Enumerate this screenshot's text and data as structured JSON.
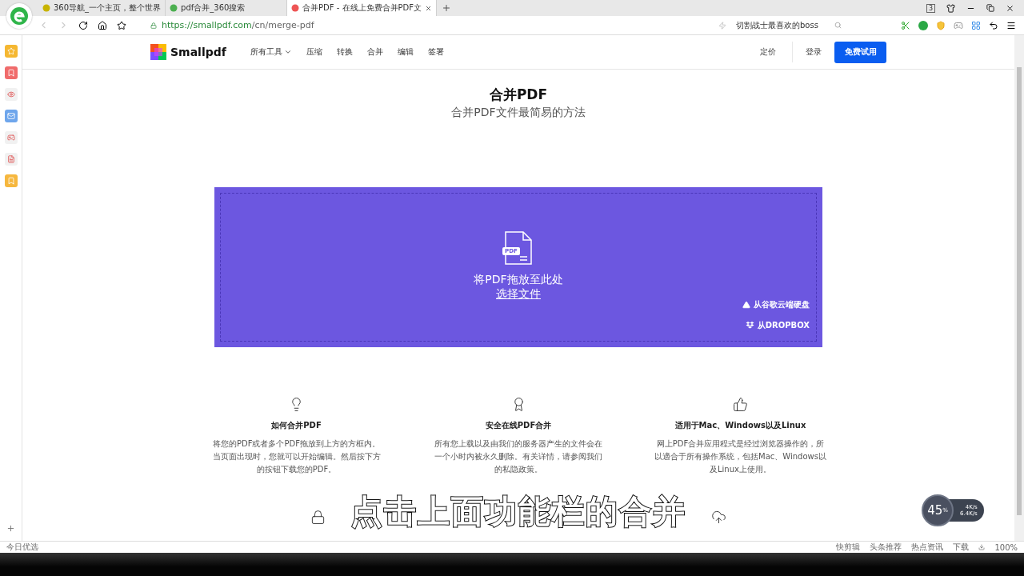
{
  "browser": {
    "tabs": [
      {
        "title": "360导航_一个主页，整个世界",
        "selected": false
      },
      {
        "title": "pdf合并_360搜索",
        "selected": false
      },
      {
        "title": "合并PDF - 在线上免费合并PDF文",
        "selected": true
      }
    ],
    "tab_count": "3",
    "url": {
      "host": "https://smallpdf.com",
      "path": "/cn/merge-pdf"
    },
    "search": {
      "value": "切割战士最喜欢的boss"
    }
  },
  "site": {
    "logo": "Smallpdf",
    "nav": [
      {
        "label": "所有工具",
        "dropdown": true
      },
      {
        "label": "压缩",
        "dropdown": false
      },
      {
        "label": "转换",
        "dropdown": false
      },
      {
        "label": "合并",
        "dropdown": false
      },
      {
        "label": "编辑",
        "dropdown": false
      },
      {
        "label": "签署",
        "dropdown": false
      }
    ],
    "pricing": "定价",
    "login": "登录",
    "cta": "免费试用"
  },
  "hero": {
    "title": "合并PDF",
    "subtitle": "合并PDF文件最简易的方法"
  },
  "dropzone": {
    "file_badge": "PDF",
    "prompt": "将PDF拖放至此处",
    "choose": "选择文件",
    "sources": [
      {
        "kind": "drive",
        "label": "从谷歌云端硬盘"
      },
      {
        "kind": "dropbox",
        "label": "从DROPBOX"
      }
    ]
  },
  "features": [
    {
      "kind": "bulb",
      "title": "如何合并PDF",
      "text": "将您的PDF或者多个PDF拖放到上方的方框内。当页面出现时，您就可以开始编辑。然后按下方的按钮下载您的PDF。"
    },
    {
      "kind": "award",
      "title": "安全在线PDF合并",
      "text": "所有您上载以及由我们的服务器产生的文件会在一个小时内被永久删除。有关详情，请参阅我们的私隐政策。"
    },
    {
      "kind": "thumb",
      "title": "适用于Mac、Windows以及Linux",
      "text": "网上PDF合并应用程式是经过浏览器操作的，所以適合于所有操作系统，包括Mac、Windows以及Linux上使用。"
    }
  ],
  "more_features": [
    {
      "kind": "lock"
    },
    {
      "kind": "cloud"
    }
  ],
  "caption": "点击上面功能栏的合并",
  "speed_widget": {
    "percent": "45",
    "unit": "%",
    "upload": "4K/s",
    "download": "6.4K/s"
  },
  "status_bar": {
    "left": "今日优选",
    "right": [
      "快剪辑",
      "头条推荐",
      "热点资讯",
      "下载"
    ],
    "zoom": "100%"
  }
}
